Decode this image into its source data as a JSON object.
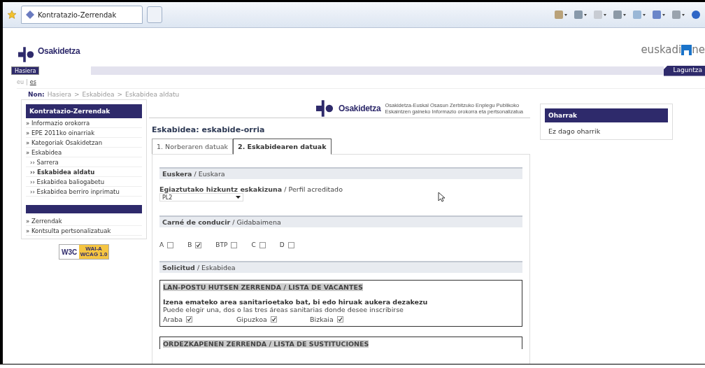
{
  "browser": {
    "tab_title": "Kontratazio-Zerrendak"
  },
  "header": {
    "brand": "Osakidetza",
    "portal_left": "euskadi",
    "portal_right": "ne"
  },
  "nav": {
    "home": "Hasiera",
    "help": "Laguntza"
  },
  "languages": [
    {
      "label": "eu",
      "selected": true
    },
    {
      "label": "es",
      "selected": false
    }
  ],
  "language_separator": "|",
  "breadcrumb": {
    "label": "Non:",
    "items": [
      "Hasiera",
      "Eskabidea",
      "Eskabidea aldatu"
    ],
    "separator": ">"
  },
  "sidebar": {
    "title": "Kontratazio-Zerrendak",
    "bullet": "»",
    "sub_bullet": "››",
    "items": [
      {
        "label": "Informazio orokorra",
        "selected": false
      },
      {
        "label": "EPE 2011ko oinarriak",
        "selected": false
      },
      {
        "label": "Kategoriak Osakidetzan",
        "selected": false
      },
      {
        "label": "Eskabidea",
        "selected": false,
        "children": [
          {
            "label": "Sarrera",
            "selected": false
          },
          {
            "label": "Eskabidea aldatu",
            "selected": true
          },
          {
            "label": "Eskabidea baliogabetu",
            "selected": false
          },
          {
            "label": "Eskabidea berriro inprimatu",
            "selected": false
          }
        ]
      }
    ],
    "items2": [
      {
        "label": "Zerrendak",
        "selected": false
      },
      {
        "label": "Kontsulta pertsonalizatuak",
        "selected": false
      }
    ],
    "badge": {
      "left": "W3C",
      "top": "WAI-A",
      "bottom": "WCAG 1.0"
    }
  },
  "banner": {
    "brand": "Osakidetza",
    "line1": "Osakidetza-Euskal Osasun Zerbitzuko Enplegu Publikoko",
    "line2": "Eskaintzen gaineko Informazio orokorra eta pertsonalizatua"
  },
  "page_title": "Eskabidea: eskabide-orria",
  "tabs": [
    {
      "label": "1. Norberaren datuak",
      "selected": false
    },
    {
      "label": "2. Eskabidearen datuak",
      "selected": true
    }
  ],
  "sections": [
    {
      "kind": "select",
      "heading": "**Euskera** / Euskara",
      "field_label": "**Egiaztutako hizkuntz eskakizuna** / Perfil acreditado",
      "value": "PL2"
    },
    {
      "kind": "checkboxes",
      "heading": "**Carné de conducir** / Gidabaimena",
      "options": [
        {
          "label": "A",
          "checked": false
        },
        {
          "label": "B",
          "checked": true
        },
        {
          "label": "BTP",
          "checked": false
        },
        {
          "label": "C",
          "checked": false
        },
        {
          "label": "D",
          "checked": false
        }
      ]
    },
    {
      "kind": "lists",
      "heading": "**Solicitud** / Eskabidea",
      "boxes": [
        {
          "title": "LAN-POSTU HUTSEN ZERRENDA / LISTA DE VACANTES",
          "instruction": "Izena emateko area sanitarioetako bat, bi edo hiruak aukera dezakezu",
          "instruction_es": "Puede elegir una, dos o las tres áreas sanitarias donde desee inscribirse",
          "areas": [
            {
              "label": "Araba",
              "checked": true
            },
            {
              "label": "Gipuzkoa",
              "checked": true
            },
            {
              "label": "Bizkaia",
              "checked": true
            }
          ]
        },
        {
          "title": "ORDEZKAPENEN ZERRENDA / LISTA DE SUSTITUCIONES"
        }
      ]
    }
  ],
  "notes": {
    "title": "Oharrak",
    "text": "Ez dago oharrik"
  }
}
